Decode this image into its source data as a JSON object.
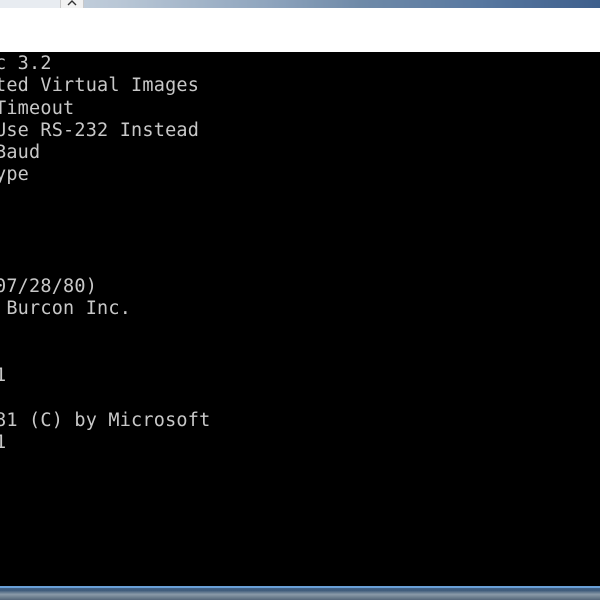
{
  "terminal": {
    "lines": [
      "c 3.2",
      "ted Virtual Images",
      "Timeout",
      "Use RS-232 Instead",
      "Baud",
      "ype",
      "",
      "",
      "",
      "",
      "07/28/80)",
      " Burcon Inc.",
      "",
      "",
      "1",
      "",
      "81 (C) by Microsoft",
      "1"
    ]
  },
  "colors": {
    "terminal_bg": "#000000",
    "terminal_fg": "#c8c8c8",
    "header_bg": "#ffffff"
  },
  "icons": {
    "scroll_up": "chevron-up-icon"
  }
}
